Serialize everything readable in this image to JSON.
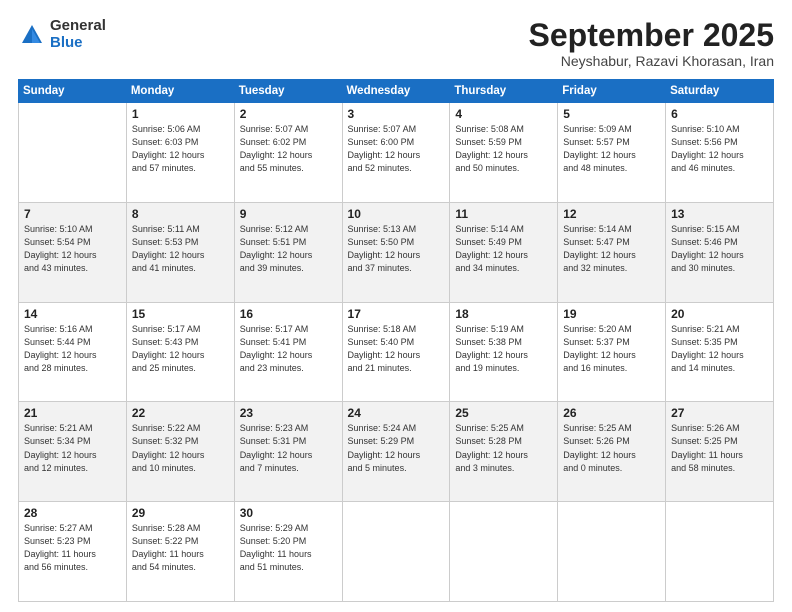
{
  "logo": {
    "general": "General",
    "blue": "Blue"
  },
  "title": "September 2025",
  "location": "Neyshabur, Razavi Khorasan, Iran",
  "weekdays": [
    "Sunday",
    "Monday",
    "Tuesday",
    "Wednesday",
    "Thursday",
    "Friday",
    "Saturday"
  ],
  "weeks": [
    [
      {
        "day": "",
        "info": ""
      },
      {
        "day": "1",
        "info": "Sunrise: 5:06 AM\nSunset: 6:03 PM\nDaylight: 12 hours\nand 57 minutes."
      },
      {
        "day": "2",
        "info": "Sunrise: 5:07 AM\nSunset: 6:02 PM\nDaylight: 12 hours\nand 55 minutes."
      },
      {
        "day": "3",
        "info": "Sunrise: 5:07 AM\nSunset: 6:00 PM\nDaylight: 12 hours\nand 52 minutes."
      },
      {
        "day": "4",
        "info": "Sunrise: 5:08 AM\nSunset: 5:59 PM\nDaylight: 12 hours\nand 50 minutes."
      },
      {
        "day": "5",
        "info": "Sunrise: 5:09 AM\nSunset: 5:57 PM\nDaylight: 12 hours\nand 48 minutes."
      },
      {
        "day": "6",
        "info": "Sunrise: 5:10 AM\nSunset: 5:56 PM\nDaylight: 12 hours\nand 46 minutes."
      }
    ],
    [
      {
        "day": "7",
        "info": "Sunrise: 5:10 AM\nSunset: 5:54 PM\nDaylight: 12 hours\nand 43 minutes."
      },
      {
        "day": "8",
        "info": "Sunrise: 5:11 AM\nSunset: 5:53 PM\nDaylight: 12 hours\nand 41 minutes."
      },
      {
        "day": "9",
        "info": "Sunrise: 5:12 AM\nSunset: 5:51 PM\nDaylight: 12 hours\nand 39 minutes."
      },
      {
        "day": "10",
        "info": "Sunrise: 5:13 AM\nSunset: 5:50 PM\nDaylight: 12 hours\nand 37 minutes."
      },
      {
        "day": "11",
        "info": "Sunrise: 5:14 AM\nSunset: 5:49 PM\nDaylight: 12 hours\nand 34 minutes."
      },
      {
        "day": "12",
        "info": "Sunrise: 5:14 AM\nSunset: 5:47 PM\nDaylight: 12 hours\nand 32 minutes."
      },
      {
        "day": "13",
        "info": "Sunrise: 5:15 AM\nSunset: 5:46 PM\nDaylight: 12 hours\nand 30 minutes."
      }
    ],
    [
      {
        "day": "14",
        "info": "Sunrise: 5:16 AM\nSunset: 5:44 PM\nDaylight: 12 hours\nand 28 minutes."
      },
      {
        "day": "15",
        "info": "Sunrise: 5:17 AM\nSunset: 5:43 PM\nDaylight: 12 hours\nand 25 minutes."
      },
      {
        "day": "16",
        "info": "Sunrise: 5:17 AM\nSunset: 5:41 PM\nDaylight: 12 hours\nand 23 minutes."
      },
      {
        "day": "17",
        "info": "Sunrise: 5:18 AM\nSunset: 5:40 PM\nDaylight: 12 hours\nand 21 minutes."
      },
      {
        "day": "18",
        "info": "Sunrise: 5:19 AM\nSunset: 5:38 PM\nDaylight: 12 hours\nand 19 minutes."
      },
      {
        "day": "19",
        "info": "Sunrise: 5:20 AM\nSunset: 5:37 PM\nDaylight: 12 hours\nand 16 minutes."
      },
      {
        "day": "20",
        "info": "Sunrise: 5:21 AM\nSunset: 5:35 PM\nDaylight: 12 hours\nand 14 minutes."
      }
    ],
    [
      {
        "day": "21",
        "info": "Sunrise: 5:21 AM\nSunset: 5:34 PM\nDaylight: 12 hours\nand 12 minutes."
      },
      {
        "day": "22",
        "info": "Sunrise: 5:22 AM\nSunset: 5:32 PM\nDaylight: 12 hours\nand 10 minutes."
      },
      {
        "day": "23",
        "info": "Sunrise: 5:23 AM\nSunset: 5:31 PM\nDaylight: 12 hours\nand 7 minutes."
      },
      {
        "day": "24",
        "info": "Sunrise: 5:24 AM\nSunset: 5:29 PM\nDaylight: 12 hours\nand 5 minutes."
      },
      {
        "day": "25",
        "info": "Sunrise: 5:25 AM\nSunset: 5:28 PM\nDaylight: 12 hours\nand 3 minutes."
      },
      {
        "day": "26",
        "info": "Sunrise: 5:25 AM\nSunset: 5:26 PM\nDaylight: 12 hours\nand 0 minutes."
      },
      {
        "day": "27",
        "info": "Sunrise: 5:26 AM\nSunset: 5:25 PM\nDaylight: 11 hours\nand 58 minutes."
      }
    ],
    [
      {
        "day": "28",
        "info": "Sunrise: 5:27 AM\nSunset: 5:23 PM\nDaylight: 11 hours\nand 56 minutes."
      },
      {
        "day": "29",
        "info": "Sunrise: 5:28 AM\nSunset: 5:22 PM\nDaylight: 11 hours\nand 54 minutes."
      },
      {
        "day": "30",
        "info": "Sunrise: 5:29 AM\nSunset: 5:20 PM\nDaylight: 11 hours\nand 51 minutes."
      },
      {
        "day": "",
        "info": ""
      },
      {
        "day": "",
        "info": ""
      },
      {
        "day": "",
        "info": ""
      },
      {
        "day": "",
        "info": ""
      }
    ]
  ]
}
